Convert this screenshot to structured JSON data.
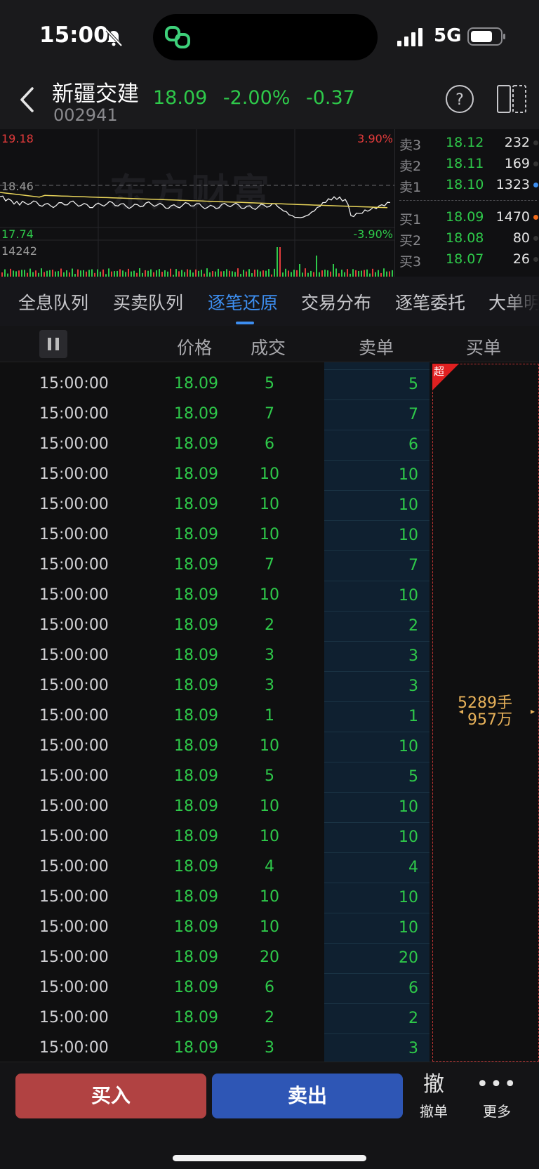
{
  "status_bar": {
    "time": "15:00",
    "network": "5G"
  },
  "header": {
    "stock_name": "新疆交建",
    "stock_code": "002941",
    "price": "18.09",
    "change_pct": "-2.00%",
    "change": "-0.37"
  },
  "chart": {
    "high": "19.18",
    "prev_close": "18.46",
    "low": "17.74",
    "pct_up": "3.90%",
    "pct_down": "-3.90%",
    "volume_max": "14242",
    "watermark": "东方财富"
  },
  "orderbook": {
    "asks": [
      {
        "label": "卖3",
        "price": "18.12",
        "volume": "232"
      },
      {
        "label": "卖2",
        "price": "18.11",
        "volume": "169"
      },
      {
        "label": "卖1",
        "price": "18.10",
        "volume": "1323"
      }
    ],
    "bids": [
      {
        "label": "买1",
        "price": "18.09",
        "volume": "1470"
      },
      {
        "label": "买2",
        "price": "18.08",
        "volume": "80"
      },
      {
        "label": "买3",
        "price": "18.07",
        "volume": "26"
      }
    ]
  },
  "tabs": [
    {
      "label": "全息队列"
    },
    {
      "label": "买卖队列"
    },
    {
      "label": "逐笔还原"
    },
    {
      "label": "交易分布"
    },
    {
      "label": "逐笔委托"
    },
    {
      "label": "大单明"
    }
  ],
  "active_tab": "逐笔还原",
  "columns": {
    "price": "价格",
    "volume": "成交",
    "sell": "卖单",
    "buy": "买单"
  },
  "big_order": {
    "tag": "超",
    "lots": "5289手",
    "amount": "957万"
  },
  "trades": [
    {
      "time": "15:00:00",
      "price": "18.09",
      "volume": "5",
      "sell": "5"
    },
    {
      "time": "15:00:00",
      "price": "18.09",
      "volume": "7",
      "sell": "7"
    },
    {
      "time": "15:00:00",
      "price": "18.09",
      "volume": "6",
      "sell": "6"
    },
    {
      "time": "15:00:00",
      "price": "18.09",
      "volume": "10",
      "sell": "10"
    },
    {
      "time": "15:00:00",
      "price": "18.09",
      "volume": "10",
      "sell": "10"
    },
    {
      "time": "15:00:00",
      "price": "18.09",
      "volume": "10",
      "sell": "10"
    },
    {
      "time": "15:00:00",
      "price": "18.09",
      "volume": "7",
      "sell": "7"
    },
    {
      "time": "15:00:00",
      "price": "18.09",
      "volume": "10",
      "sell": "10"
    },
    {
      "time": "15:00:00",
      "price": "18.09",
      "volume": "2",
      "sell": "2"
    },
    {
      "time": "15:00:00",
      "price": "18.09",
      "volume": "3",
      "sell": "3"
    },
    {
      "time": "15:00:00",
      "price": "18.09",
      "volume": "3",
      "sell": "3"
    },
    {
      "time": "15:00:00",
      "price": "18.09",
      "volume": "1",
      "sell": "1"
    },
    {
      "time": "15:00:00",
      "price": "18.09",
      "volume": "10",
      "sell": "10"
    },
    {
      "time": "15:00:00",
      "price": "18.09",
      "volume": "5",
      "sell": "5"
    },
    {
      "time": "15:00:00",
      "price": "18.09",
      "volume": "10",
      "sell": "10"
    },
    {
      "time": "15:00:00",
      "price": "18.09",
      "volume": "10",
      "sell": "10"
    },
    {
      "time": "15:00:00",
      "price": "18.09",
      "volume": "4",
      "sell": "4"
    },
    {
      "time": "15:00:00",
      "price": "18.09",
      "volume": "10",
      "sell": "10"
    },
    {
      "time": "15:00:00",
      "price": "18.09",
      "volume": "10",
      "sell": "10"
    },
    {
      "time": "15:00:00",
      "price": "18.09",
      "volume": "20",
      "sell": "20"
    },
    {
      "time": "15:00:00",
      "price": "18.09",
      "volume": "6",
      "sell": "6"
    },
    {
      "time": "15:00:00",
      "price": "18.09",
      "volume": "2",
      "sell": "2"
    },
    {
      "time": "15:00:00",
      "price": "18.09",
      "volume": "3",
      "sell": "3"
    }
  ],
  "bottom_bar": {
    "buy": "买入",
    "sell": "卖出",
    "cancel_glyph": "撤",
    "cancel": "撤单",
    "more": "更多"
  },
  "colors": {
    "up": "#e33b3b",
    "down": "#2ec94a",
    "accent": "#3d8ef0",
    "gold": "#e8b25a"
  }
}
